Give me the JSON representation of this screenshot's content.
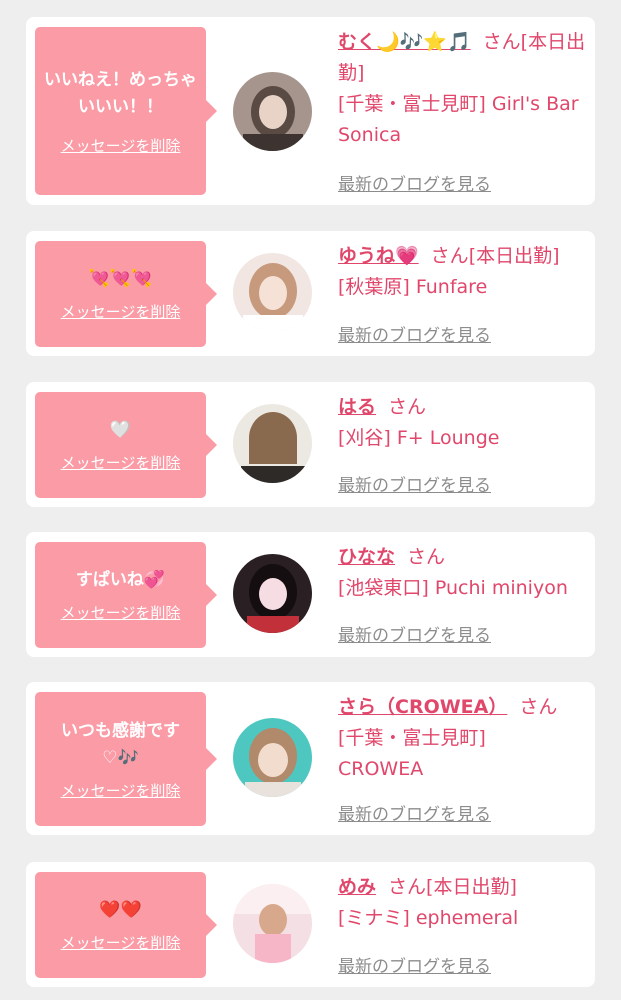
{
  "cards": [
    {
      "message": "いいねえ！めっちゃいいい！！",
      "delete_label": "メッセージを削除",
      "name": "むく🌙🎶⭐️🎵",
      "san": "さん",
      "status": "[本日出勤]",
      "shop": "[千葉・富士見町] Girl's Bar Sonica",
      "blog_link": "最新のブログを見る"
    },
    {
      "message": "💘💘💘",
      "delete_label": "メッセージを削除",
      "name": "ゆうね💗",
      "san": "さん",
      "status": "[本日出勤]",
      "shop": "[秋葉原] Funfare",
      "blog_link": "最新のブログを見る"
    },
    {
      "message": "🤍",
      "delete_label": "メッセージを削除",
      "name": "はる",
      "san": "さん",
      "status": "",
      "shop": "[刈谷] F+ Lounge",
      "blog_link": "最新のブログを見る"
    },
    {
      "message": "すぱいね💞",
      "delete_label": "メッセージを削除",
      "name": "ひなな",
      "san": "さん",
      "status": "",
      "shop": "[池袋東口] Puchi miniyon",
      "blog_link": "最新のブログを見る"
    },
    {
      "message": "いつも感謝です♡🎶",
      "delete_label": "メッセージを削除",
      "name": "さら（CROWEA）",
      "san": "さん",
      "status": "",
      "shop": "[千葉・富士見町] CROWEA",
      "blog_link": "最新のブログを見る"
    },
    {
      "message": "❤️❤️",
      "delete_label": "メッセージを削除",
      "name": "めみ",
      "san": "さん",
      "status": "[本日出勤]",
      "shop": "[ミナミ] ephemeral",
      "blog_link": "最新のブログを見る"
    }
  ],
  "colors": {
    "bubble": "#fa9ba6",
    "accent": "#e0476b",
    "link_gray": "#8c8c8c",
    "background": "#eeeeee"
  }
}
